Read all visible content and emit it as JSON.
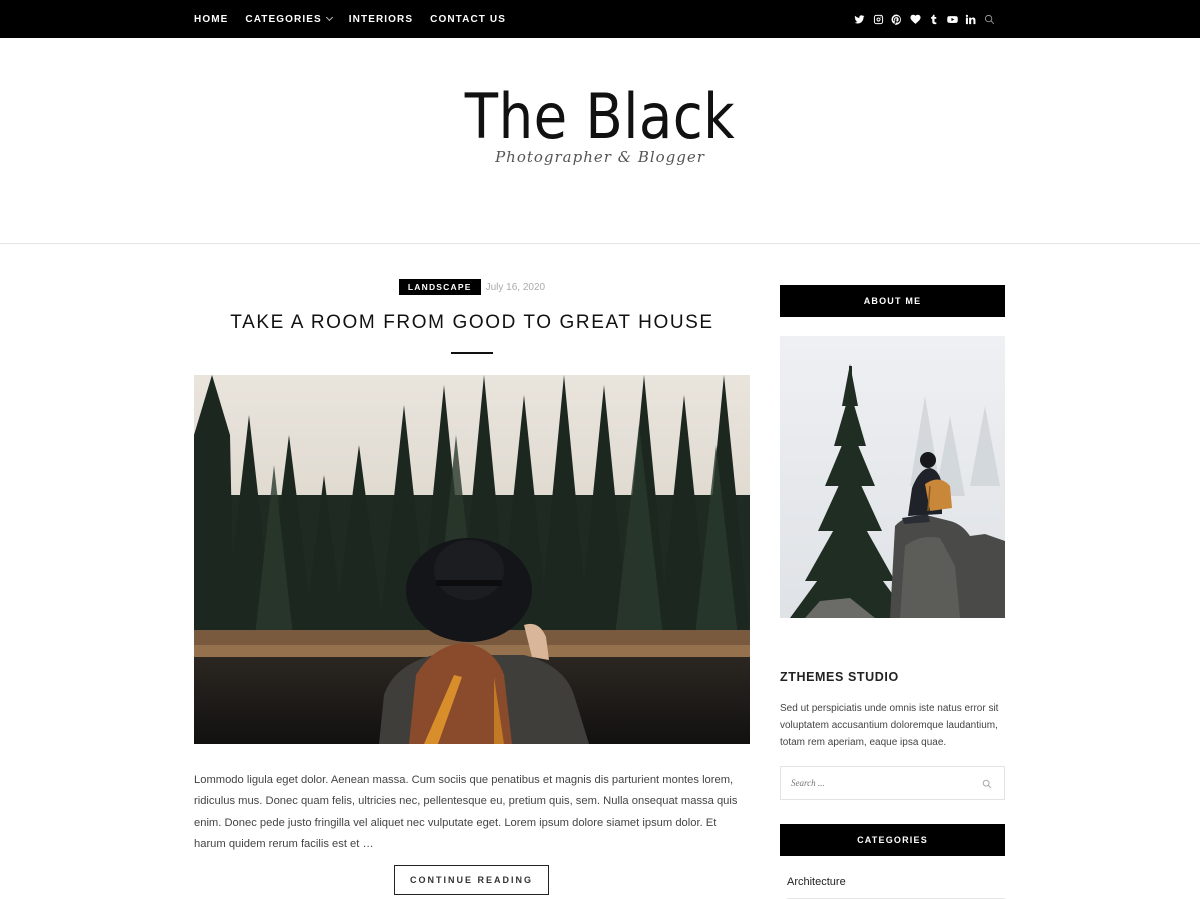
{
  "nav": {
    "items": [
      {
        "label": "HOME"
      },
      {
        "label": "CATEGORIES"
      },
      {
        "label": "INTERIORS"
      },
      {
        "label": "CONTACT US"
      }
    ]
  },
  "social": [
    "twitter-icon",
    "instagram-icon",
    "pinterest-icon",
    "bloglovin-icon",
    "tumblr-icon",
    "youtube-icon",
    "linkedin-icon",
    "search-icon"
  ],
  "header": {
    "logo": "The Black",
    "tagline": "Photographer & Blogger"
  },
  "post": {
    "category": "LANDSCAPE",
    "date": "July 16, 2020",
    "title": "TAKE A ROOM FROM GOOD TO GREAT HOUSE",
    "excerpt": "Lommodo ligula eget dolor. Aenean massa. Cum sociis que penatibus et magnis dis parturient montes lorem, ridiculus mus. Donec quam felis, ultricies nec, pellentesque eu, pretium quis, sem. Nulla onsequat massa quis enim. Donec pede justo fringilla vel aliquet nec vulputate eget. Lorem ipsum dolore siamet ipsum dolor. Et harum quidem rerum facilis est et …",
    "continue_label": "CONTINUE READING"
  },
  "sidebar": {
    "about_title": "ABOUT ME",
    "studio_title": "ZTHEMES STUDIO",
    "studio_text": "Sed ut perspiciatis unde omnis iste natus error sit voluptatem accusantium doloremque laudantium, totam rem aperiam, eaque ipsa quae.",
    "search_placeholder": "Search ...",
    "categories_title": "CATEGORIES",
    "categories": [
      "Architecture"
    ]
  },
  "colors": {
    "topbar": "#000000",
    "accent": "#000000",
    "text": "#222222"
  }
}
